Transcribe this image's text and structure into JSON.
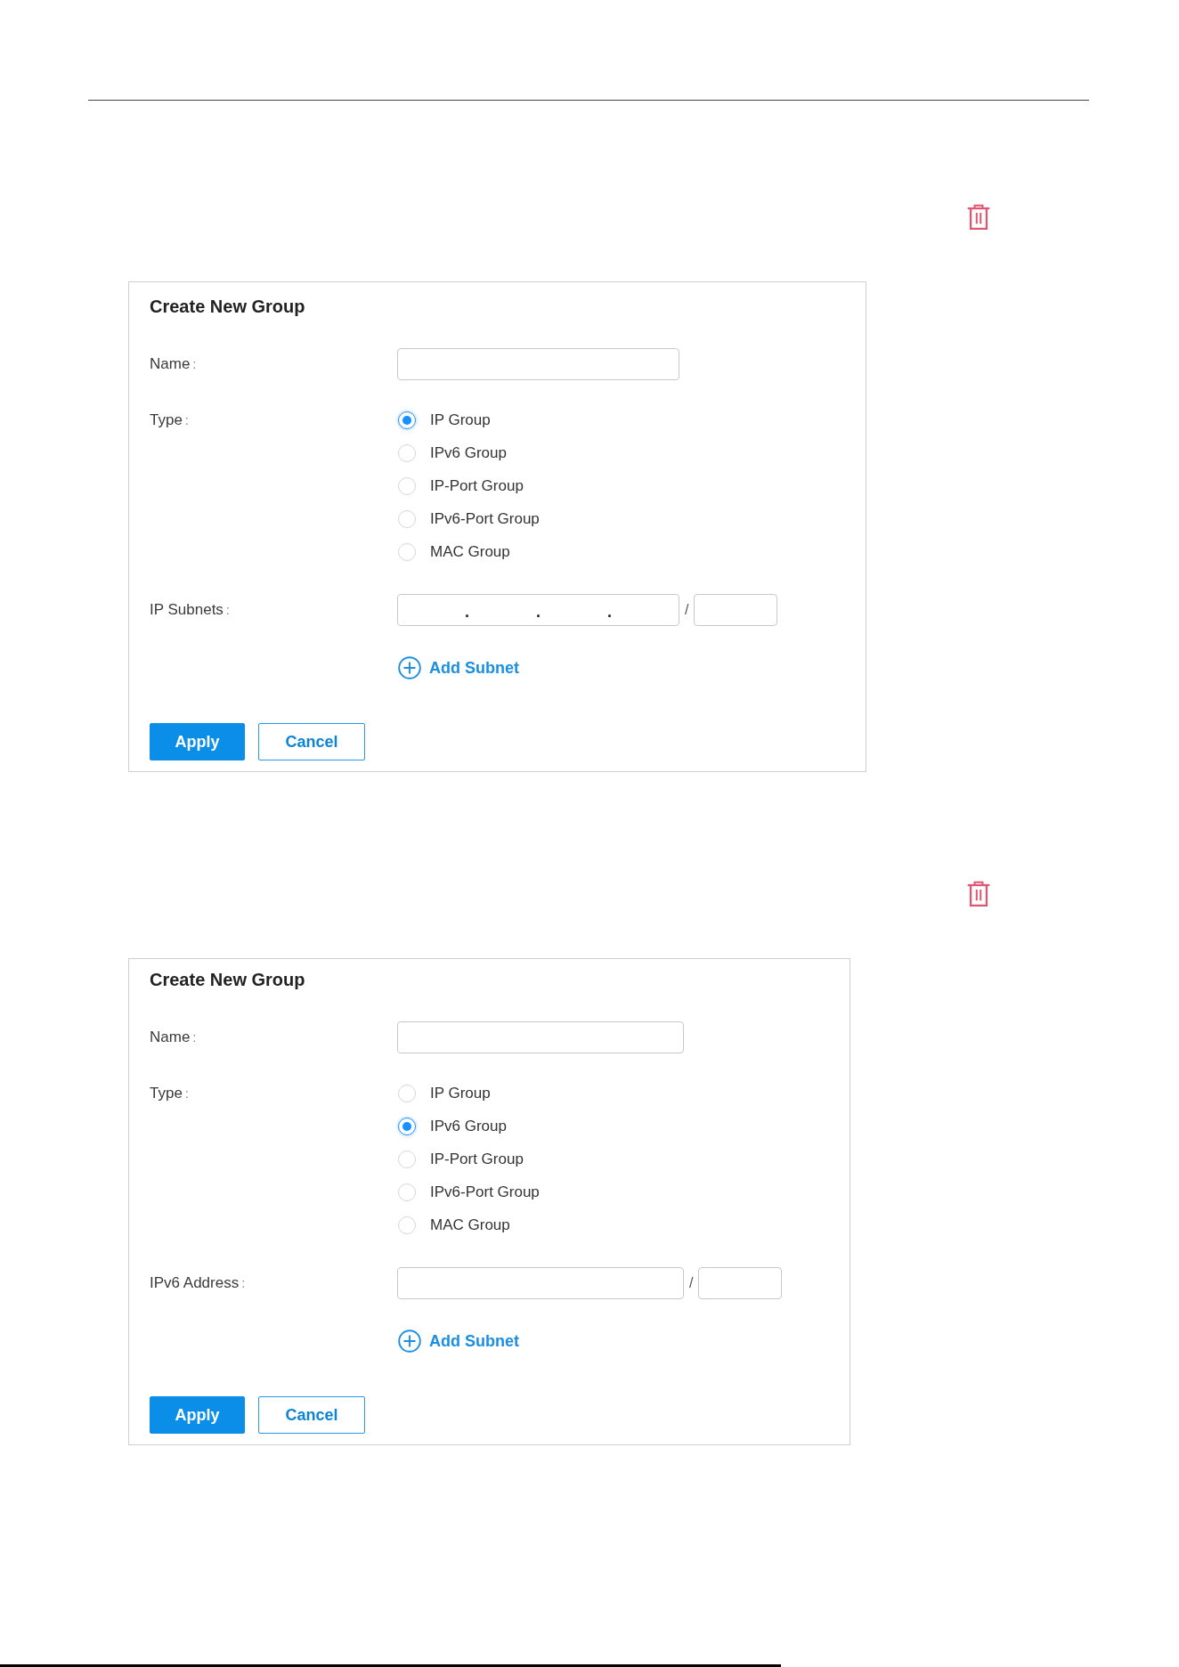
{
  "groups": [
    {
      "title": "Create New Group",
      "fields": [
        {
          "kind": "text",
          "label": "Name",
          "colon": ":"
        },
        {
          "kind": "radio",
          "label": "Type",
          "colon": ":",
          "options": [
            {
              "label": "IP Group",
              "selected": true
            },
            {
              "label": "IPv6 Group",
              "selected": false
            },
            {
              "label": "IP-Port Group",
              "selected": false
            },
            {
              "label": "IPv6-Port Group",
              "selected": false
            },
            {
              "label": "MAC Group",
              "selected": false
            }
          ]
        },
        {
          "kind": "address",
          "label": "IP Subnets",
          "colon": ":",
          "separators": [
            ".",
            ".",
            "."
          ],
          "prefix_separator": "/"
        }
      ],
      "add_link": "Add Subnet",
      "buttons": [
        {
          "label": "Apply",
          "kind": "primary"
        },
        {
          "label": "Cancel",
          "kind": "secondary"
        }
      ]
    },
    {
      "title": "Create New Group",
      "fields": [
        {
          "kind": "text",
          "label": "Name",
          "colon": ":"
        },
        {
          "kind": "radio",
          "label": "Type",
          "colon": ":",
          "options": [
            {
              "label": "IP Group",
              "selected": false
            },
            {
              "label": "IPv6 Group",
              "selected": true
            },
            {
              "label": "IP-Port Group",
              "selected": false
            },
            {
              "label": "IPv6-Port Group",
              "selected": false
            },
            {
              "label": "MAC Group",
              "selected": false
            }
          ]
        },
        {
          "kind": "address",
          "label": "IPv6 Address",
          "colon": ":",
          "prefix_separator": "/"
        }
      ],
      "add_link": "Add Subnet",
      "buttons": [
        {
          "label": "Apply",
          "kind": "primary"
        },
        {
          "label": "Cancel",
          "kind": "secondary"
        }
      ]
    }
  ]
}
